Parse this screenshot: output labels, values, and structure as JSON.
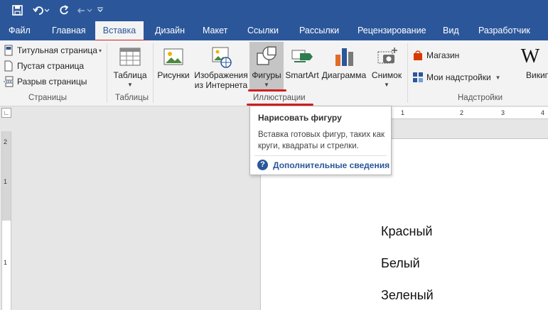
{
  "qat": {
    "save_icon": "save-icon",
    "undo_icon": "undo-icon",
    "redo_icon": "redo-icon",
    "customize_icon": "qat-dropdown-icon"
  },
  "tabs": [
    {
      "label": "Файл"
    },
    {
      "label": "Главная"
    },
    {
      "label": "Вставка"
    },
    {
      "label": "Дизайн"
    },
    {
      "label": "Макет"
    },
    {
      "label": "Ссылки"
    },
    {
      "label": "Рассылки"
    },
    {
      "label": "Рецензирование"
    },
    {
      "label": "Вид"
    },
    {
      "label": "Разработчик"
    }
  ],
  "ribbon": {
    "pages": {
      "cover_page": "Титульная страница",
      "blank_page": "Пустая страница",
      "page_break": "Разрыв страницы",
      "group_label": "Страницы"
    },
    "tables": {
      "table": "Таблица",
      "group_label": "Таблицы"
    },
    "illustrations": {
      "pictures": "Рисунки",
      "online_pictures_line1": "Изображения",
      "online_pictures_line2": "из Интернета",
      "shapes": "Фигуры",
      "smartart": "SmartArt",
      "chart": "Диаграмма",
      "screenshot": "Снимок",
      "group_label": "Иллюстрации"
    },
    "addins": {
      "store": "Магазин",
      "my_addins": "Мои надстройки",
      "wikipedia": "Википедия",
      "group_label": "Надстройки"
    }
  },
  "tooltip": {
    "title": "Нарисовать фигуру",
    "description": "Вставка готовых фигур, таких как круги, квадраты и стрелки.",
    "help_link": "Дополнительные сведения"
  },
  "ruler": {
    "h_numbers": [
      "1",
      "2",
      "3",
      "4"
    ],
    "v_numbers": [
      "2",
      "1",
      "1"
    ]
  },
  "document": {
    "lines": [
      "Красный",
      "Белый",
      "Зеленый"
    ]
  },
  "colors": {
    "accent": "#2b579a",
    "highlight": "#d21f1f"
  }
}
